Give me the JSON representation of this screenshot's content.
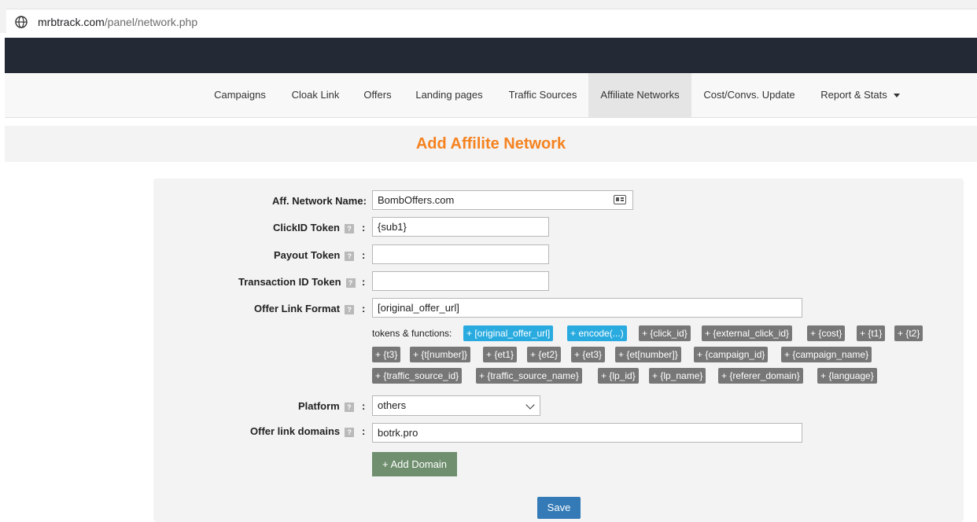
{
  "browser": {
    "url_host": "mrbtrack.com",
    "url_path": "/panel/network.php",
    "globe_icon": "globe-icon"
  },
  "nav": {
    "items": [
      {
        "label": "Campaigns"
      },
      {
        "label": "Cloak Link"
      },
      {
        "label": "Offers"
      },
      {
        "label": "Landing pages"
      },
      {
        "label": "Traffic Sources"
      },
      {
        "label": "Affiliate Networks",
        "active": true
      },
      {
        "label": "Cost/Convs. Update"
      },
      {
        "label": "Report & Stats",
        "dropdown": true
      }
    ]
  },
  "page": {
    "title": "Add Affilite Network",
    "title_color": "#f5821f"
  },
  "form": {
    "network_name_label": "Aff. Network Name:",
    "network_name_value": "BombOffers.com",
    "clickid_label": "ClickID Token",
    "clickid_value": "{sub1}",
    "payout_label": "Payout Token",
    "payout_value": "",
    "transaction_label": "Transaction ID Token",
    "transaction_value": "",
    "offer_link_label": "Offer Link Format",
    "offer_link_value": "[original_offer_url]",
    "help_glyph": "?",
    "colon": ":",
    "tokens_label": "tokens & functions:",
    "tokens": [
      "+ [original_offer_url]",
      "+ encode(...)",
      "+ {click_id}",
      "+ {external_click_id}",
      "+ {cost}",
      "+ {t1}",
      "+ {t2}",
      "+ {t3}",
      "+ {t[number]}",
      "+ {et1}",
      "+ {et2}",
      "+ {et3}",
      "+ {et[number]}",
      "+ {campaign_id}",
      "+ {campaign_name}",
      "+ {traffic_source_id}",
      "+ {traffic_source_name}",
      "+ {lp_id}",
      "+ {lp_name}",
      "+ {referer_domain}",
      "+ {language}"
    ],
    "platform_label": "Platform",
    "platform_value": "others",
    "domains_label": "Offer link domains",
    "domains_value": "botrk.pro",
    "add_domain_label": "+ Add Domain",
    "save_label": "Save"
  },
  "colors": {
    "dark_header": "#232a36",
    "token_blue": "#29abe0",
    "token_gray": "#777777",
    "save_blue": "#337ab7",
    "add_domain_green": "#6f8f6f"
  }
}
